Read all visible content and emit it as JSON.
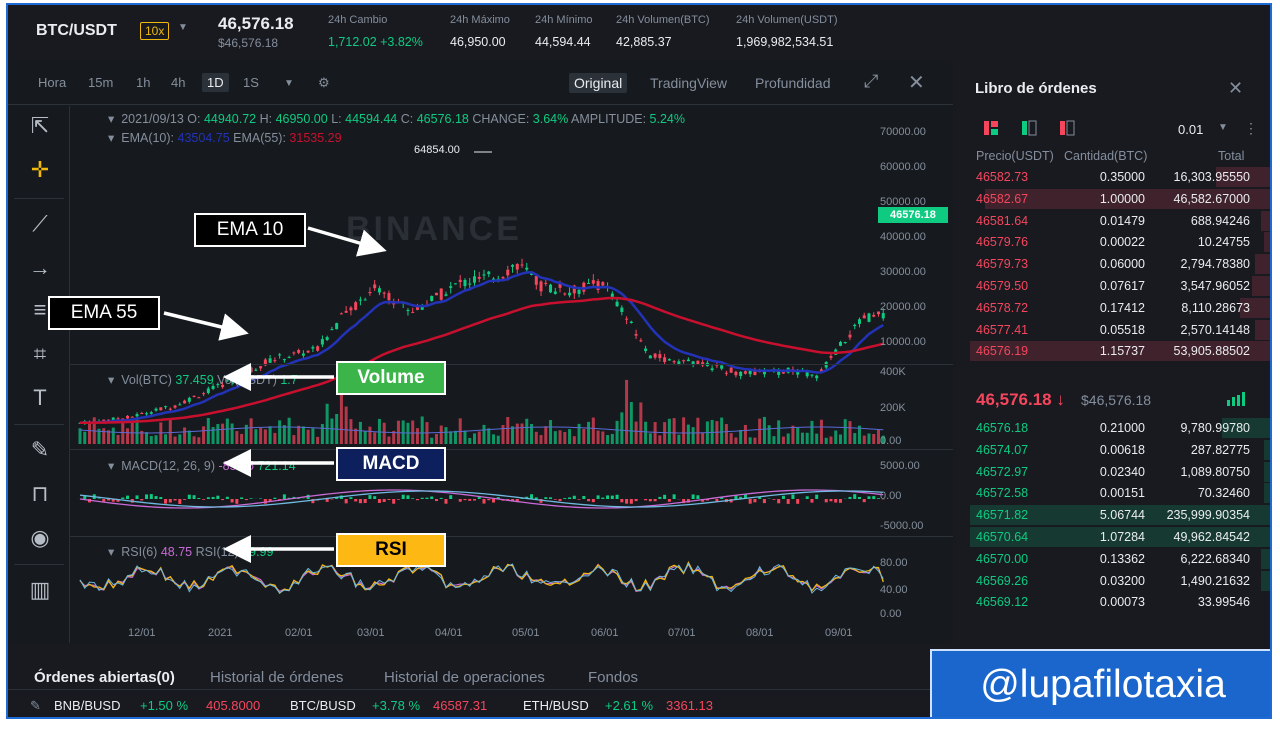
{
  "header": {
    "symbol": "BTC/USDT",
    "leverage": "10x",
    "last_price": "46,576.18",
    "last_price_fiat": "$46,576.18",
    "stats": [
      {
        "label": "24h Cambio",
        "value": "1,712.02 +3.82%",
        "color": "#0ecb81"
      },
      {
        "label": "24h Máximo",
        "value": "46,950.00",
        "color": "#eaecef"
      },
      {
        "label": "24h Mínimo",
        "value": "44,594.44",
        "color": "#eaecef"
      },
      {
        "label": "24h Volumen(BTC)",
        "value": "42,885.37",
        "color": "#eaecef"
      },
      {
        "label": "24h Volumen(USDT)",
        "value": "1,969,982,534.51",
        "color": "#eaecef"
      }
    ]
  },
  "chart_toolbar": {
    "timeframes": [
      "Hora",
      "15m",
      "1h",
      "4h",
      "1D",
      "1S"
    ],
    "active_timeframe": "1D",
    "views": [
      "Original",
      "TradingView",
      "Profundidad"
    ],
    "active_view": "Original"
  },
  "legend": {
    "ohlc": {
      "date": "2021/09/13",
      "o_label": "O:",
      "o": "44940.72",
      "h_label": "H:",
      "h": "46950.00",
      "l_label": "L:",
      "l": "44594.44",
      "c_label": "C:",
      "c": "46576.18",
      "change_label": "CHANGE:",
      "change": "3.64%",
      "amp_label": "AMPLITUDE:",
      "amp": "5.24%"
    },
    "ema": {
      "ema10_label": "EMA(10):",
      "ema10": "43504.75",
      "ema55_label": "EMA(55):",
      "ema55": "31535.29"
    },
    "vol": {
      "label": "Vol(BTC)",
      "value": "37.459",
      "label2": "Vol(USDT)",
      "value2": "1.7"
    },
    "macd": {
      "label": "MACD(12, 26, 9)",
      "v1": "-85.25",
      "v2": "721.14"
    },
    "rsi": {
      "label": "RSI(6)",
      "v1": "48.75",
      "label2": "RSI(12)",
      "v2": "49.99"
    }
  },
  "price_axis": [
    "70000.00",
    "60000.00",
    "50000.00",
    "40000.00",
    "30000.00",
    "20000.00",
    "10000.00"
  ],
  "vol_axis": [
    "400K",
    "200K",
    "0.00"
  ],
  "macd_axis": [
    "5000.00",
    "0.00",
    "-5000.00"
  ],
  "rsi_axis": [
    "80.00",
    "40.00",
    "0.00"
  ],
  "x_axis": [
    "12/01",
    "2021",
    "02/01",
    "03/01",
    "04/01",
    "05/01",
    "06/01",
    "07/01",
    "08/01",
    "09/01"
  ],
  "high_marker": "64854.00",
  "price_tag": "46576.18",
  "watermark": "BINANCE",
  "annotations": {
    "ema10": "EMA 10",
    "ema55": "EMA 55",
    "volume": "Volume",
    "macd": "MACD",
    "rsi": "RSI"
  },
  "orderbook": {
    "title": "Libro de órdenes",
    "precision": "0.01",
    "headers": {
      "price": "Precio(USDT)",
      "qty": "Cantidad(BTC)",
      "total": "Total"
    },
    "asks": [
      {
        "price": "46582.73",
        "qty": "0.35000",
        "total": "16,303.95550",
        "depth": 0.18
      },
      {
        "price": "46582.67",
        "qty": "1.00000",
        "total": "46,582.67000",
        "depth": 0.95
      },
      {
        "price": "46581.64",
        "qty": "0.01479",
        "total": "688.94246",
        "depth": 0.03
      },
      {
        "price": "46579.76",
        "qty": "0.00022",
        "total": "10.24755",
        "depth": 0.02
      },
      {
        "price": "46579.73",
        "qty": "0.06000",
        "total": "2,794.78380",
        "depth": 0.05
      },
      {
        "price": "46579.50",
        "qty": "0.07617",
        "total": "3,547.96052",
        "depth": 0.06
      },
      {
        "price": "46578.72",
        "qty": "0.17412",
        "total": "8,110.28673",
        "depth": 0.1
      },
      {
        "price": "46577.41",
        "qty": "0.05518",
        "total": "2,570.14148",
        "depth": 0.05
      },
      {
        "price": "46576.19",
        "qty": "1.15737",
        "total": "53,905.88502",
        "depth": 1.0
      }
    ],
    "mid_price": "46,576.18",
    "mid_arrow": "↓",
    "mid_fiat": "$46,576.18",
    "bids": [
      {
        "price": "46576.18",
        "qty": "0.21000",
        "total": "9,780.99780",
        "depth": 0.16
      },
      {
        "price": "46574.07",
        "qty": "0.00618",
        "total": "287.82775",
        "depth": 0.02
      },
      {
        "price": "46572.97",
        "qty": "0.02340",
        "total": "1,089.80750",
        "depth": 0.02
      },
      {
        "price": "46572.58",
        "qty": "0.00151",
        "total": "70.32460",
        "depth": 0.02
      },
      {
        "price": "46571.82",
        "qty": "5.06744",
        "total": "235,999.90354",
        "depth": 1.0
      },
      {
        "price": "46570.64",
        "qty": "1.07284",
        "total": "49,962.84542",
        "depth": 1.0
      },
      {
        "price": "46570.00",
        "qty": "0.13362",
        "total": "6,222.68340",
        "depth": 0.03
      },
      {
        "price": "46569.26",
        "qty": "0.03200",
        "total": "1,490.21632",
        "depth": 0.03
      },
      {
        "price": "46569.12",
        "qty": "0.00073",
        "total": "33.99546",
        "depth": 0.0
      }
    ]
  },
  "bottom_tabs": [
    "Órdenes abiertas(0)",
    "Historial de órdenes",
    "Historial de operaciones",
    "Fondos"
  ],
  "ticker": [
    {
      "pair": "BNB/BUSD",
      "change": "+1.50 %",
      "price": "405.8000",
      "price_color": "#f6465d"
    },
    {
      "pair": "BTC/BUSD",
      "change": "+3.78 %",
      "price": "46587.31",
      "price_color": "#f6465d"
    },
    {
      "pair": "ETH/BUSD",
      "change": "+2.61 %",
      "price": "3361.13",
      "price_color": "#f6465d"
    }
  ],
  "brand": "@lupafilotaxia",
  "colors": {
    "up": "#0ecb81",
    "down": "#f6465d",
    "ema10": "#2233b8",
    "ema55": "#c8102e",
    "accent": "#f0b90b"
  }
}
